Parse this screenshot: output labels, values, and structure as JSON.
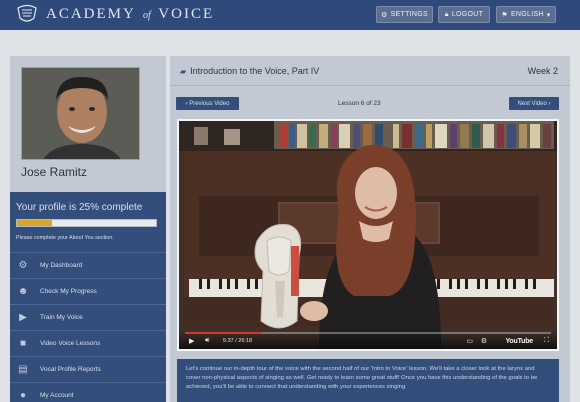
{
  "brand": {
    "name_part1": "ACADEMY",
    "name_of": "of",
    "name_part2": "VOICE",
    "icon": "crest-icon"
  },
  "topnav": {
    "settings": {
      "label": "SETTINGS",
      "icon": "gear-icon"
    },
    "logout": {
      "label": "LOGOUT",
      "icon": "lock-icon"
    },
    "language": {
      "label": "ENGLISH",
      "icon": "flag-icon",
      "chevron": "chevron-down-icon"
    }
  },
  "user": {
    "name": "Jose Ramitz"
  },
  "profile": {
    "title": "Your profile is 25% complete",
    "percent": 25,
    "note": "Please complete your About You section."
  },
  "menu": [
    {
      "label": "My Dashboard",
      "icon": "gear-icon"
    },
    {
      "label": "Check My Progress",
      "icon": "head-icon"
    },
    {
      "label": "Train My Voice",
      "icon": "play-icon"
    },
    {
      "label": "Video Voice Lessons",
      "icon": "video-camera-icon"
    },
    {
      "label": "Vocal Profile Reports",
      "icon": "document-icon"
    },
    {
      "label": "My Account",
      "icon": "user-icon"
    }
  ],
  "lesson": {
    "title": "Introduction to the Voice, Part IV",
    "week": "Week 2",
    "prev_label": "‹ Previous Video",
    "next_label": "Next Video ›",
    "count": "Lesson 6 of 23"
  },
  "video": {
    "current_time": "5:37",
    "duration": "26:18",
    "time_display": "5:37 / 26:18",
    "progress_fraction": 0.21,
    "provider": "YouTube"
  },
  "description": {
    "text": "Let's continue our in-depth tour of the voice with the second half of our 'Intro to Voice' lesson. We'll take a closer look at the larynx and cover non-physical aspects of singing as well. Get ready to learn some great stuff! Once you have this understanding of the goals to be achieved, you'll be able to connect that understanding with your experiences singing"
  },
  "colors": {
    "navy": "#2f4a7a",
    "accent": "#e0a91f",
    "page_bg": "#e9ecef",
    "panel_bg": "#c9d0d9"
  }
}
